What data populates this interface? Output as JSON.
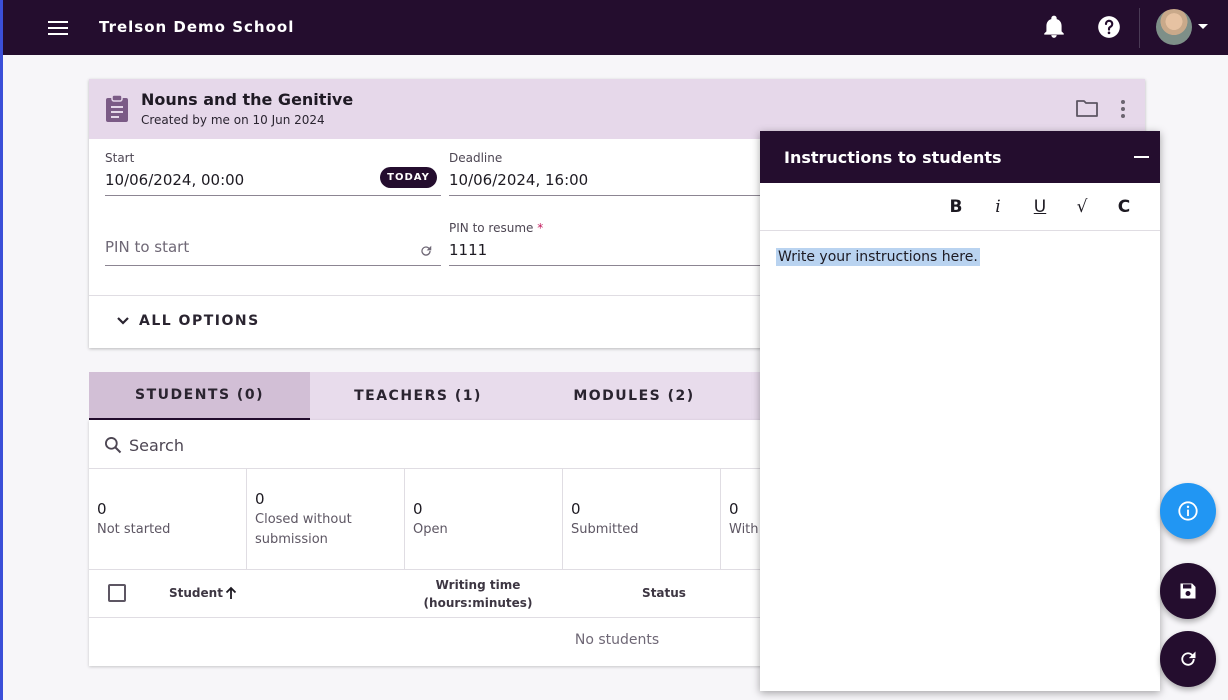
{
  "app": {
    "title": "Trelson Demo School"
  },
  "header": {
    "menu_icon": "hamburger-menu-icon",
    "notification_icon": "bell-icon",
    "help_icon": "help-circle-icon"
  },
  "assignment": {
    "title": "Nouns and the Genitive",
    "subtitle": "Created by me on 10 Jun 2024",
    "start_label": "Start",
    "start_value": "10/06/2024, 00:00",
    "today_label": "TODAY",
    "deadline_label": "Deadline",
    "deadline_value": "10/06/2024, 16:00",
    "pin_start_placeholder": "PIN to start",
    "pin_resume_label": "PIN to resume",
    "pin_resume_required": "*",
    "pin_resume_value": "1111",
    "all_options": "ALL OPTIONS"
  },
  "tabs": [
    {
      "label": "STUDENTS (0)",
      "active": true
    },
    {
      "label": "TEACHERS (1)",
      "active": false
    },
    {
      "label": "MODULES (2)",
      "active": false
    }
  ],
  "students": {
    "search_placeholder": "Search",
    "stats": [
      {
        "count": "0",
        "label": "Not started"
      },
      {
        "count": "0",
        "label": "Closed without submission"
      },
      {
        "count": "0",
        "label": "Open"
      },
      {
        "count": "0",
        "label": "Submitted"
      },
      {
        "count": "0",
        "label": "With"
      }
    ],
    "columns": {
      "student": "Student",
      "writing_time": "Writing time (hours:minutes)",
      "status": "Status"
    },
    "empty_text": "No students"
  },
  "instructions_panel": {
    "title": "Instructions to students",
    "toolbar": [
      "B",
      "i",
      "U",
      "√",
      "C"
    ],
    "content": "Write your instructions here."
  },
  "fabs": {
    "info_icon": "info-icon",
    "save_icon": "save-icon",
    "reload_icon": "reload-icon"
  },
  "colors": {
    "topbar": "#240d2e",
    "card_header": "#e6d8ea",
    "tab_bar": "#e8dcec",
    "active_tab": "#d2bfd6",
    "info_fab": "#2196f3",
    "selection": "#b9d3f0"
  }
}
